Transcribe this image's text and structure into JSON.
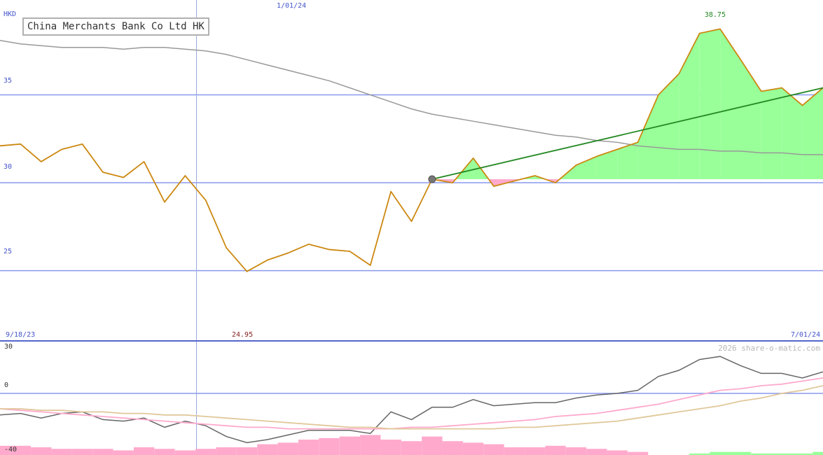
{
  "title": "China Merchants Bank Co Ltd HK",
  "currency": "HKD",
  "watermark": "2026 share-o-matic.com",
  "colors": {
    "price": "#cc8811",
    "ma_long": "#999999",
    "trend": "#228822",
    "fill_up": "#99ff99",
    "fill_down": "#ffaacc",
    "gridline": "#8899ee",
    "osc": "#666666",
    "osc_pink": "#ffaacc",
    "osc_tan": "#e0c89a"
  },
  "chart_data": [
    {
      "type": "line",
      "panel": "price",
      "yunit": "HKD",
      "ylim": [
        21,
        40
      ],
      "yticks": [
        25,
        30,
        35
      ],
      "x_start": "9/18/23",
      "x_mid": "1/01/24",
      "x_end": "7/01/24",
      "high_label": "38.75",
      "low_label": "24.95",
      "series": [
        {
          "role": "price",
          "values": [
            32.1,
            32.2,
            31.2,
            31.9,
            32.2,
            30.6,
            30.3,
            31.2,
            28.9,
            30.4,
            29.0,
            26.3,
            24.95,
            25.6,
            26.0,
            26.5,
            26.2,
            26.1,
            25.3,
            29.5,
            27.8,
            30.2,
            30.0,
            31.4,
            29.8,
            30.1,
            30.4,
            30.0,
            31.0,
            31.5,
            31.9,
            32.3,
            35.0,
            36.2,
            38.5,
            38.75,
            37.0,
            35.2,
            35.4,
            34.4,
            35.4
          ]
        },
        {
          "role": "moving-average",
          "values": [
            38.1,
            37.9,
            37.8,
            37.7,
            37.7,
            37.7,
            37.6,
            37.7,
            37.7,
            37.6,
            37.5,
            37.3,
            37.0,
            36.7,
            36.4,
            36.1,
            35.8,
            35.4,
            35.0,
            34.6,
            34.2,
            33.9,
            33.7,
            33.5,
            33.3,
            33.1,
            32.9,
            32.7,
            32.6,
            32.4,
            32.3,
            32.1,
            32.0,
            31.9,
            31.9,
            31.8,
            31.8,
            31.7,
            31.7,
            31.6,
            31.6
          ]
        },
        {
          "role": "trend",
          "from_index": 21,
          "to_index": 40,
          "from_value": 30.2,
          "to_value": 35.4
        }
      ]
    },
    {
      "type": "line",
      "panel": "oscillator",
      "ylim": [
        -40,
        30
      ],
      "yticks": [
        -40,
        0,
        30
      ],
      "series": [
        {
          "role": "oscillator",
          "values": [
            -14,
            -13,
            -16,
            -13,
            -12,
            -17,
            -18,
            -16,
            -22,
            -18,
            -21,
            -28,
            -32,
            -30,
            -27,
            -24,
            -24,
            -24,
            -26,
            -12,
            -17,
            -9,
            -9,
            -4,
            -8,
            -7,
            -6,
            -6,
            -3,
            -1,
            0,
            2,
            11,
            15,
            22,
            24,
            18,
            13,
            13,
            10,
            14
          ]
        },
        {
          "role": "signal-fast",
          "values": [
            -10,
            -11,
            -12,
            -13,
            -14,
            -15,
            -16,
            -17,
            -18,
            -19,
            -20,
            -21,
            -22,
            -22,
            -23,
            -23,
            -23,
            -23,
            -23,
            -23,
            -22,
            -22,
            -21,
            -20,
            -19,
            -18,
            -17,
            -15,
            -14,
            -13,
            -11,
            -9,
            -7,
            -4,
            -1,
            2,
            3,
            5,
            6,
            8,
            10
          ]
        },
        {
          "role": "signal-slow",
          "values": [
            -10,
            -10,
            -11,
            -11,
            -12,
            -12,
            -13,
            -13,
            -14,
            -14,
            -15,
            -16,
            -17,
            -18,
            -19,
            -20,
            -21,
            -22,
            -22,
            -23,
            -23,
            -23,
            -23,
            -23,
            -23,
            -22,
            -22,
            -21,
            -20,
            -19,
            -18,
            -16,
            -14,
            -12,
            -10,
            -8,
            -5,
            -3,
            0,
            2,
            5
          ]
        },
        {
          "role": "histogram",
          "values": [
            -34,
            -34,
            -35,
            -36,
            -36,
            -36,
            -37,
            -35,
            -36,
            -37,
            -36,
            -35,
            -35,
            -33,
            -32,
            -30,
            -29,
            -28,
            -27,
            -30,
            -31,
            -28,
            -31,
            -32,
            -33,
            -35,
            -35,
            -34,
            -35,
            -36,
            -37,
            -38,
            -40,
            -40,
            -39,
            -38,
            -38,
            -39,
            -39,
            -39,
            -38
          ]
        }
      ]
    }
  ]
}
